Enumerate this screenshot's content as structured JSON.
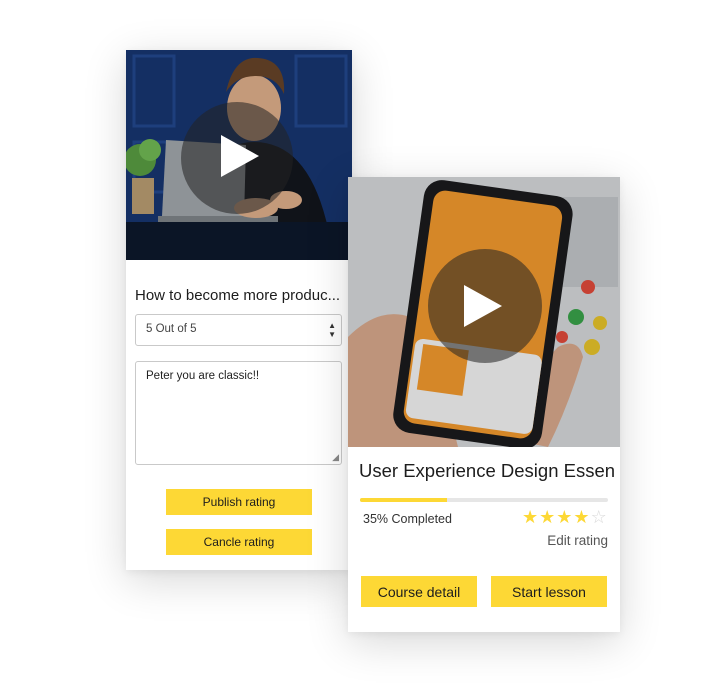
{
  "colors": {
    "accent": "#fdd835",
    "text": "#1d1d1d"
  },
  "left_card": {
    "media": {
      "alt": "video thumbnail",
      "play_icon": "play-icon"
    },
    "title": "How to become more produc...",
    "rating_select": {
      "selected": "5 Out of 5"
    },
    "comment": {
      "value": "Peter you are classic!!"
    },
    "publish_label": "Publish rating",
    "cancel_label": "Cancle rating"
  },
  "right_card": {
    "media": {
      "alt": "video thumbnail",
      "play_icon": "play-icon"
    },
    "title": "User Experience Design Essen..",
    "progress": {
      "percent": 35,
      "label": "35% Completed"
    },
    "rating": {
      "value": 4,
      "max": 5
    },
    "edit_rating_label": "Edit rating",
    "course_detail_label": "Course detail",
    "start_lesson_label": "Start lesson"
  }
}
